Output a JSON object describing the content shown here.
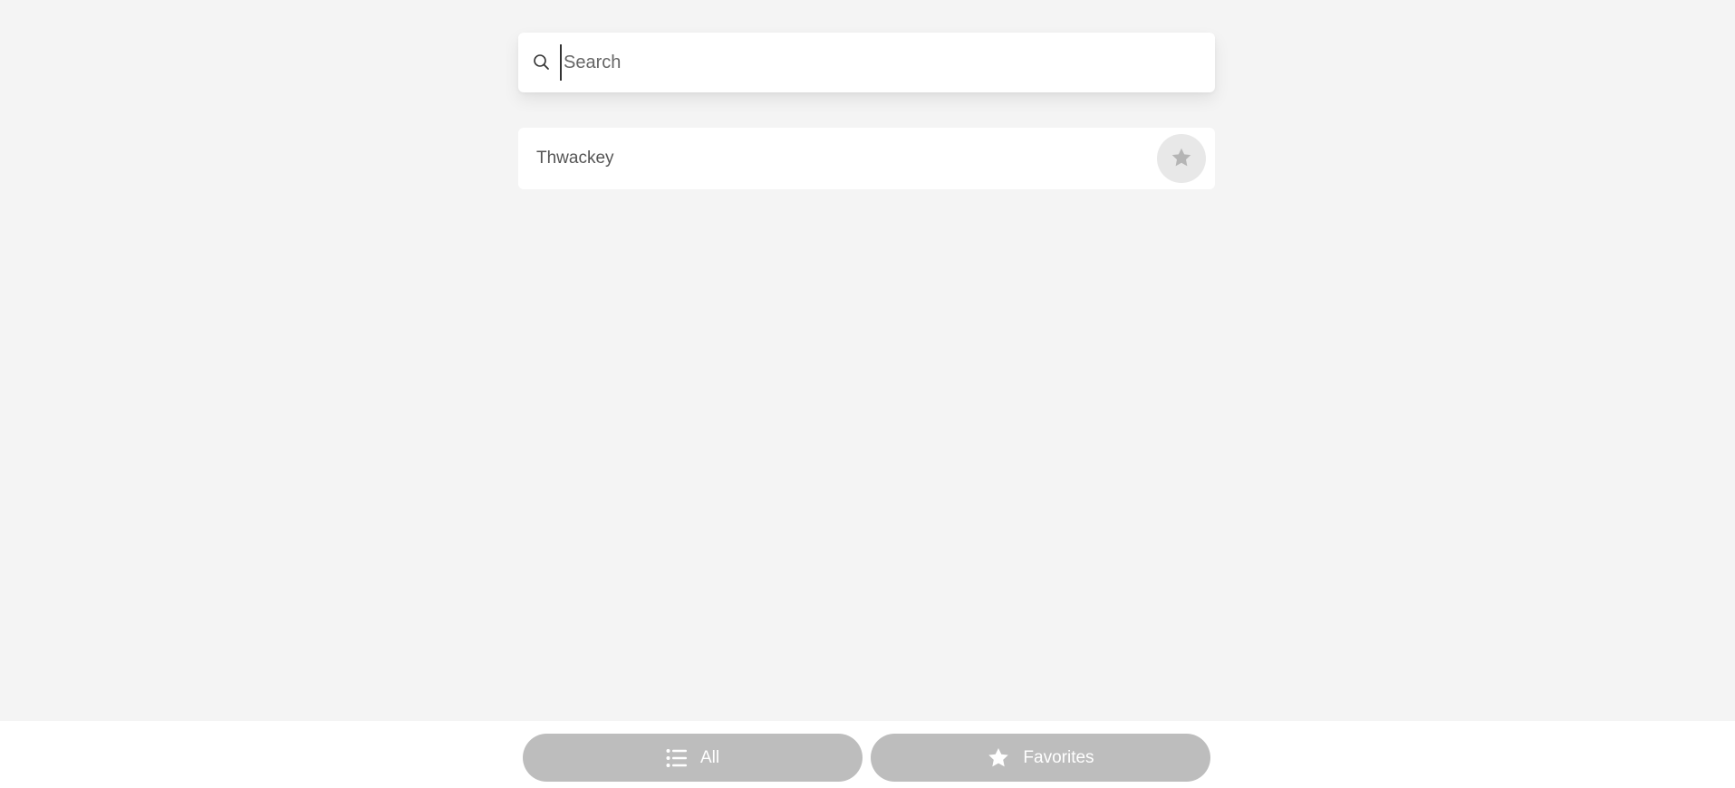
{
  "search": {
    "placeholder": "Search",
    "value": "",
    "icon": "search-icon"
  },
  "items": [
    {
      "label": "Thwackey",
      "favorite": false,
      "icon": "star-icon"
    }
  ],
  "tabs": {
    "all": {
      "label": "All",
      "icon": "list-icon"
    },
    "favorites": {
      "label": "Favorites",
      "icon": "star-icon"
    }
  },
  "colors": {
    "background": "#f4f4f4",
    "card": "#ffffff",
    "tab_bg": "#bdbdbd",
    "fav_circle": "#e8e8e8",
    "star": "#b5b5b5"
  }
}
